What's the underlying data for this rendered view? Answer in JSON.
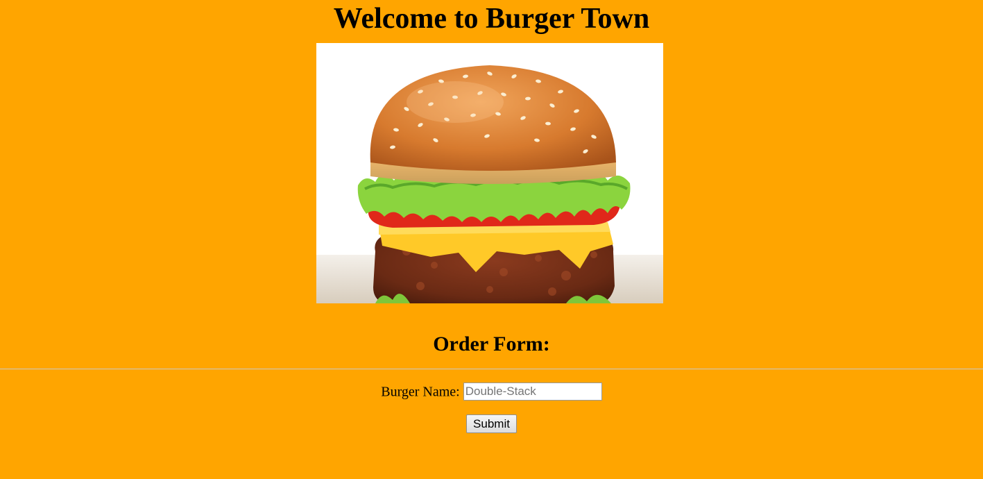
{
  "page": {
    "title": "Welcome to Burger Town",
    "background_color": "#FFA500"
  },
  "hero_image": {
    "icon": "burger-photo"
  },
  "order_section": {
    "heading": "Order Form:"
  },
  "form": {
    "burger_name_label": "Burger Name:",
    "burger_name_value": "",
    "burger_name_placeholder": "Double-Stack",
    "submit_label": "Submit"
  }
}
